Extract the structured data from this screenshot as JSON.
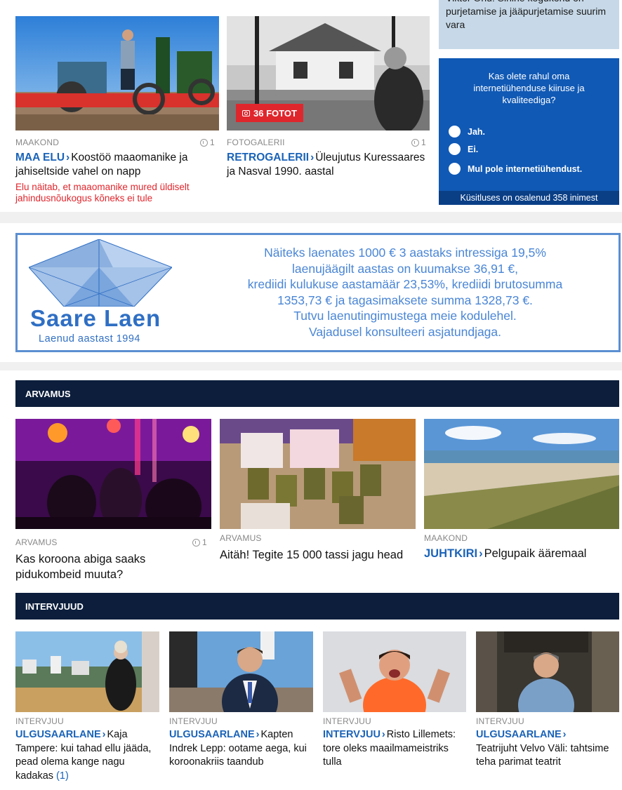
{
  "top_row": {
    "articles": [
      {
        "category": "MAAKOND",
        "comments": "1",
        "section": "MAA ELU",
        "title": "Koostöö maaomanike ja jahiseltside vahel on napp",
        "lead": "Elu näitab, et maaomanike mured üldiselt jahindusnõukogus kõneks ei tule"
      },
      {
        "category": "FOTOGALERII",
        "comments": "1",
        "badge": "36 FOTOT",
        "section": "RETROGALERII",
        "title": "Üleujutus Kuressaares ja Nasval 1990. aastal"
      }
    ],
    "side_article": "Viktor Ohu: Sinine kogukond on purjetamise ja jääpurjetamise suurim vara"
  },
  "poll": {
    "question": "Kas olete rahul oma internetiühenduse kiiruse ja kvaliteediga?",
    "options": [
      "Jah.",
      "Ei.",
      "Mul pole internetiühendust."
    ],
    "footer": "Küsitluses on osalenud 358 inimest"
  },
  "ad": {
    "brand": "Saare Laen",
    "tagline": "Laenud aastast 1994",
    "lines": [
      "Näiteks laenates 1000 € 3 aastaks intressiga 19,5%",
      "laenujäägilt aastas on kuumakse 36,91 €,",
      "krediidi kulukuse aastamäär 23,53%, krediidi brutosumma",
      "1353,73 € ja tagasimaksete summa 1328,73 €.",
      "Tutvu laenutingimustega meie kodulehel.",
      "Vajadusel konsulteeri asjatundjaga."
    ]
  },
  "arvamus": {
    "title": "ARVAMUS",
    "articles": [
      {
        "category": "ARVAMUS",
        "comments": "1",
        "title": "Kas koroona abiga saaks pidukombeid muuta?"
      },
      {
        "category": "ARVAMUS",
        "title": "Aitäh! Tegite 15 000 tassi jagu head"
      },
      {
        "category": "MAAKOND",
        "section": "JUHTKIRI",
        "title": "Pelgupaik ääremaal"
      }
    ]
  },
  "intervjuud": {
    "title": "INTERVJUUD",
    "articles": [
      {
        "category": "INTERVJUU",
        "section": "ULGUSAARLANE",
        "title": "Kaja Tampere: kui tahad ellu jääda, pead olema kange nagu kadakas",
        "count": "(1)"
      },
      {
        "category": "INTERVJUU",
        "section": "ULGUSAARLANE",
        "title": "Kapten Indrek Lepp: ootame aega, kui koroonakriis taandub"
      },
      {
        "category": "INTERVJUU",
        "section": "INTERVJUU",
        "title": "Risto Lillemets: tore oleks maailmameistriks tulla"
      },
      {
        "category": "INTERVJUU",
        "section": "ULGUSAARLANE",
        "title": "Teatrijuht Velvo Väli: tahtsime teha parimat teatrit"
      }
    ]
  }
}
